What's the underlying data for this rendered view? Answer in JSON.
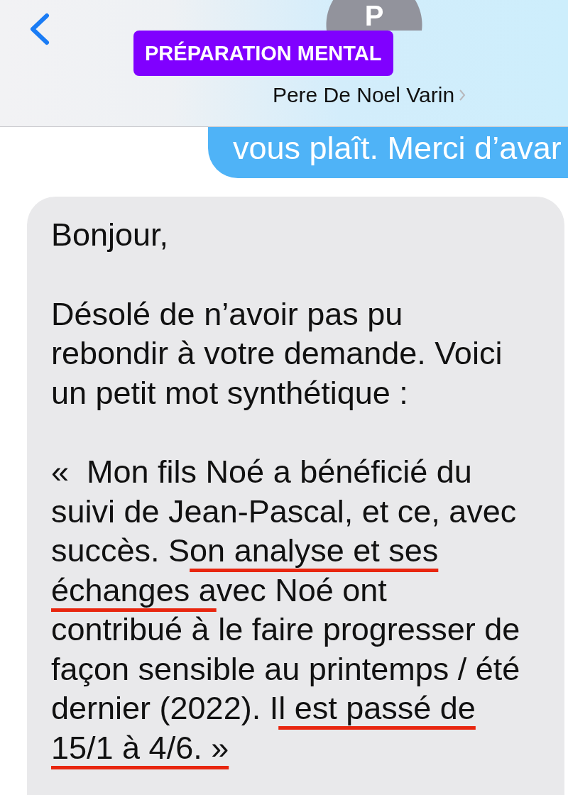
{
  "header": {
    "avatar_initial": "P",
    "badge": "PRÉPARATION MENTAL",
    "contact_name": "Pere De Noel Varin"
  },
  "messages": [
    {
      "kind": "sent",
      "paragraphs": [
        [
          {
            "text": "vous plaît. Merci d’avar",
            "underlined": false
          }
        ]
      ]
    },
    {
      "kind": "received",
      "paragraphs": [
        [
          {
            "text": "Bonjour,",
            "underlined": false
          }
        ],
        [
          {
            "text": "Désolé de n’avoir pas pu\nrebondir à votre demande. Voici\nun petit mot synthétique :",
            "underlined": false
          }
        ],
        [
          {
            "text": "«  Mon fils Noé a bénéficié du\nsuivi de Jean-Pascal, et ce, avec\nsuccès. S",
            "underlined": false
          },
          {
            "text": "on analyse et ses\néchanges a",
            "underlined": true
          },
          {
            "text": "vec Noé ont\ncontribué à le faire progresser de\nfaçon sensible au printemps / été\ndernier (2022). I",
            "underlined": false
          },
          {
            "text": "l est passé de\n15/1 à 4/6. »",
            "underlined": true
          }
        ]
      ]
    }
  ]
}
